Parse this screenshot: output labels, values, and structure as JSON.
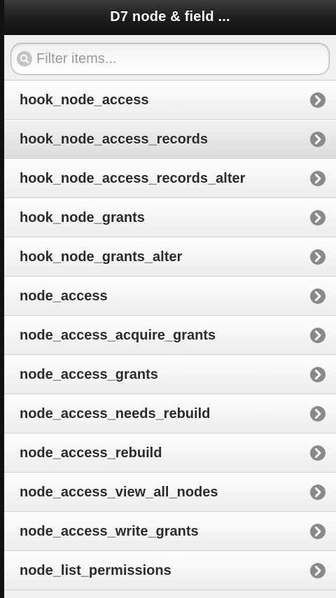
{
  "header": {
    "title": "D7 node & field ..."
  },
  "search": {
    "placeholder": "Filter items...",
    "value": "",
    "icon": "search-icon"
  },
  "list": {
    "items": [
      {
        "label": "hook_node_access",
        "icon": "chevron-right-icon"
      },
      {
        "label": "hook_node_access_records",
        "icon": "chevron-right-icon",
        "active": true
      },
      {
        "label": "hook_node_access_records_alter",
        "icon": "chevron-right-icon"
      },
      {
        "label": "hook_node_grants",
        "icon": "chevron-right-icon"
      },
      {
        "label": "hook_node_grants_alter",
        "icon": "chevron-right-icon"
      },
      {
        "label": "node_access",
        "icon": "chevron-right-icon"
      },
      {
        "label": "node_access_acquire_grants",
        "icon": "chevron-right-icon"
      },
      {
        "label": "node_access_grants",
        "icon": "chevron-right-icon"
      },
      {
        "label": "node_access_needs_rebuild",
        "icon": "chevron-right-icon"
      },
      {
        "label": "node_access_rebuild",
        "icon": "chevron-right-icon"
      },
      {
        "label": "node_access_view_all_nodes",
        "icon": "chevron-right-icon"
      },
      {
        "label": "node_access_write_grants",
        "icon": "chevron-right-icon"
      },
      {
        "label": "node_list_permissions",
        "icon": "chevron-right-icon"
      }
    ]
  },
  "colors": {
    "header_bg": "#1c1c1c",
    "header_text": "#ffffff",
    "item_text": "#2b2b2b",
    "arrow_circle": "#8a8a8a"
  }
}
